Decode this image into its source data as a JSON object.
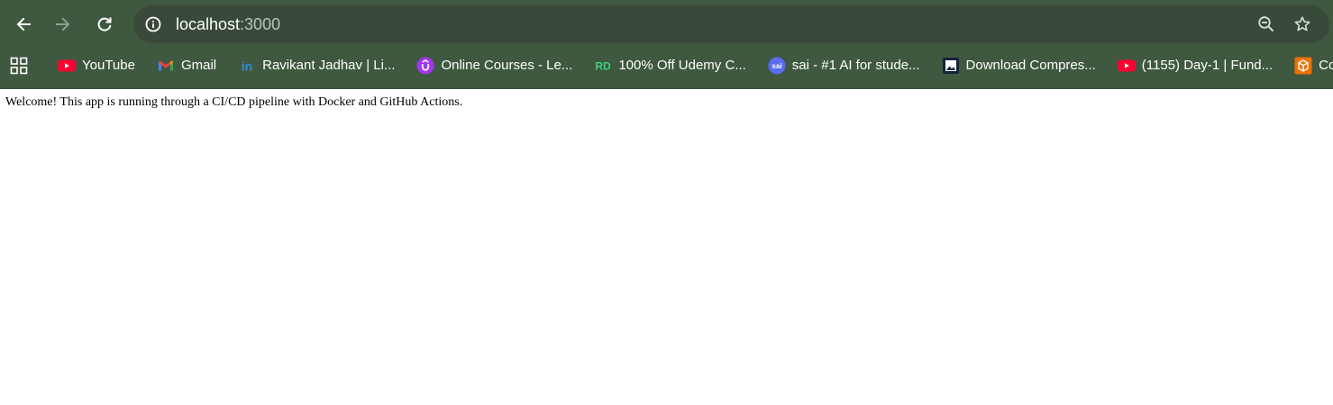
{
  "browser": {
    "address_bar": {
      "host": "localhost",
      "port": ":3000"
    },
    "icons": {
      "back": "arrow-left-icon",
      "forward": "arrow-right-icon",
      "reload": "reload-icon",
      "site_info": "info-icon",
      "zoom": "zoom-out-icon",
      "bookmark": "star-icon",
      "apps": "apps-grid-icon"
    },
    "colors": {
      "frame": "#3f5840",
      "omnibox": "#394a3a",
      "text": "#ffffff"
    }
  },
  "bookmarks": [
    {
      "label": "YouTube",
      "icon": "youtube-icon"
    },
    {
      "label": "Gmail",
      "icon": "gmail-icon"
    },
    {
      "label": "Ravikant Jadhav | Li...",
      "icon": "linkedin-icon"
    },
    {
      "label": "Online Courses - Le...",
      "icon": "udemy-icon"
    },
    {
      "label": "100% Off Udemy C...",
      "icon": "real-discount-icon"
    },
    {
      "label": "sai - #1 AI for stude...",
      "icon": "sai-icon"
    },
    {
      "label": "Download Compres...",
      "icon": "image-icon"
    },
    {
      "label": "(1155) Day-1 | Fund...",
      "icon": "youtube-icon"
    },
    {
      "label": "Console",
      "icon": "aws-icon"
    }
  ],
  "page": {
    "message": "Welcome! This app is running through a CI/CD pipeline with Docker and GitHub Actions."
  }
}
